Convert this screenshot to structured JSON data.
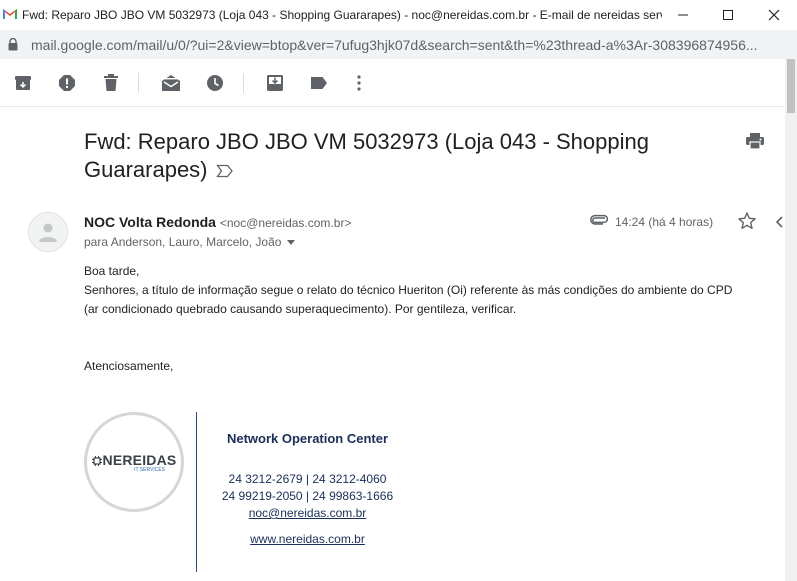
{
  "window": {
    "title": "Fwd: Reparo JBO JBO VM 5032973 (Loja 043 - Shopping Guararapes) - noc@nereidas.com.br - E-mail de nereidas servi..."
  },
  "address_bar": {
    "url": "mail.google.com/mail/u/0/?ui=2&view=btop&ver=7ufug3hjk07d&search=sent&th=%23thread-a%3Ar-308396874956..."
  },
  "toolbar": {
    "icons": [
      "archive-icon",
      "report-spam-icon",
      "delete-icon",
      "mark-unread-icon",
      "snooze-icon",
      "move-to-icon",
      "label-icon",
      "more-icon"
    ]
  },
  "email": {
    "subject": "Fwd: Reparo JBO JBO VM 5032973 (Loja 043 - Shopping Guararapes)",
    "sender_name": "NOC Volta Redonda",
    "sender_email": "<noc@nereidas.com.br>",
    "recipients": "para Anderson, Lauro, Marcelo, João",
    "time": "14:24 (há 4 horas)",
    "body": {
      "greeting": "Boa tarde,",
      "line1": "Senhores, a título de informação segue o relato do técnico Hueriton (Oi) referente às más condições do ambiente do CPD",
      "line2": "(ar condicionado quebrado causando superaquecimento). Por gentileza, verificar.",
      "closing": "Atenciosamente,"
    }
  },
  "signature": {
    "logo_text": "NEREIDAS",
    "logo_sub": "IT SERVICES",
    "title": "Network Operation Center",
    "phones_line1": "24 3212-2679 | 24 3212-4060",
    "phones_line2": "24 99219-2050 | 24 99863-1666",
    "email": "noc@nereidas.com.br",
    "website": "www.nereidas.com.br"
  },
  "colors": {
    "accent_dark_blue": "#1a2e5a",
    "text_primary": "#202124",
    "text_secondary": "#5f6368",
    "icon_gray": "#5f6368"
  }
}
